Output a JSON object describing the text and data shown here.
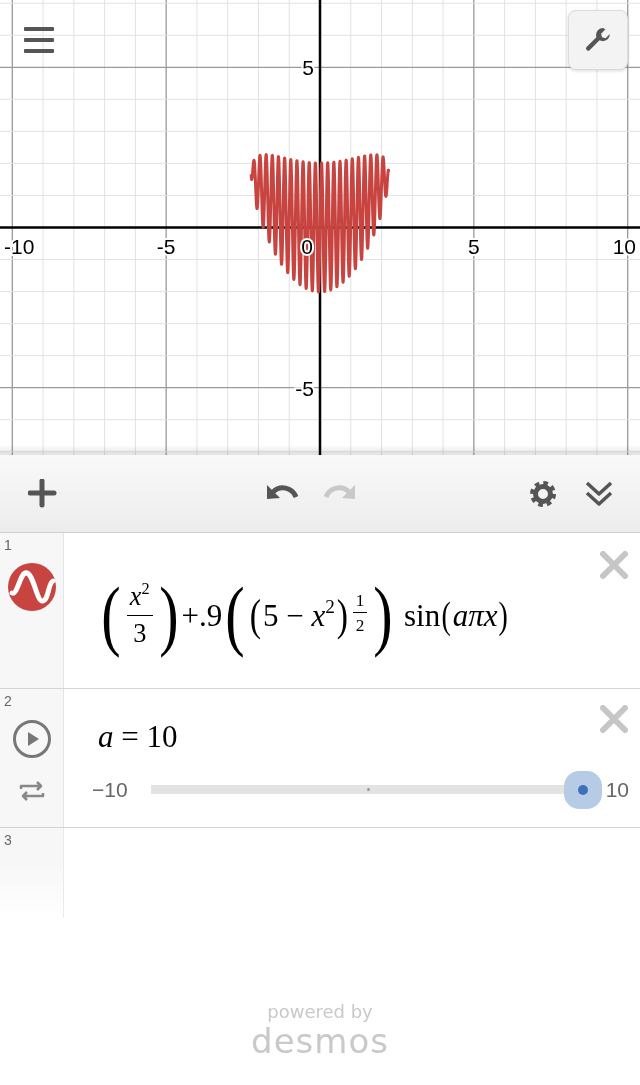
{
  "graph": {
    "chart_data": {
      "type": "line",
      "grid": true,
      "xlim": [
        -10.4,
        10.4
      ],
      "ylim": [
        -7.1,
        7.1
      ],
      "xticks": [
        {
          "value": -10,
          "label": "-10"
        },
        {
          "value": -5,
          "label": "-5"
        },
        {
          "value": 5,
          "label": "5"
        },
        {
          "value": 10,
          "label": "10"
        }
      ],
      "yticks": [
        {
          "value": -5,
          "label": "-5"
        },
        {
          "value": 5,
          "label": "5"
        }
      ]
    },
    "origin_label": "0"
  },
  "toolbar": {
    "buttons": [
      {
        "kind": "add",
        "disabled": false
      },
      {
        "kind": "undo",
        "disabled": false
      },
      {
        "kind": "redo",
        "disabled": true
      },
      {
        "kind": "settings",
        "disabled": false
      },
      {
        "kind": "collapse",
        "disabled": false
      }
    ]
  },
  "expressions": [
    {
      "kind": "function",
      "number": "1",
      "color": "#c74440",
      "math": [
        {
          "kind": "paren",
          "open": "(",
          "close": ")",
          "children": [
            {
              "kind": "frac",
              "num": [
                {
                  "kind": "text",
                  "text": "x",
                  "italic": true
                },
                {
                  "kind": "sup",
                  "children": [
                    {
                      "kind": "text",
                      "text": "2",
                      "italic": false
                    }
                  ]
                }
              ],
              "den": [
                {
                  "kind": "text",
                  "text": "3",
                  "italic": false
                }
              ]
            }
          ]
        },
        {
          "kind": "text",
          "text": "+.9",
          "italic": false
        },
        {
          "kind": "paren",
          "open": "(",
          "close": ")",
          "children": [
            {
              "kind": "paren",
              "open": "(",
              "close": ")",
              "children": [
                {
                  "kind": "text",
                  "text": "5 − ",
                  "italic": false
                },
                {
                  "kind": "text",
                  "text": "x",
                  "italic": true
                },
                {
                  "kind": "sup",
                  "children": [
                    {
                      "kind": "text",
                      "text": "2",
                      "italic": false
                    }
                  ]
                }
              ]
            },
            {
              "kind": "sup",
              "children": [
                {
                  "kind": "frac",
                  "num": [
                    {
                      "kind": "text",
                      "text": "1",
                      "italic": false
                    }
                  ],
                  "den": [
                    {
                      "kind": "text",
                      "text": "2",
                      "italic": false
                    }
                  ]
                }
              ]
            }
          ]
        },
        {
          "kind": "text",
          "text": " sin",
          "italic": false
        },
        {
          "kind": "paren",
          "open": "(",
          "close": ")",
          "children": [
            {
              "kind": "text",
              "text": "aπx",
              "italic": true
            }
          ]
        }
      ]
    },
    {
      "kind": "slider",
      "number": "2",
      "math": [
        {
          "kind": "text",
          "text": "a",
          "italic": true
        },
        {
          "kind": "text",
          "text": " = 10",
          "italic": false
        }
      ],
      "slider": {
        "min": "−10",
        "max": "10"
      }
    },
    {
      "kind": "empty",
      "number": "3"
    }
  ],
  "footer": {
    "powered_by": "powered by",
    "brand": "desmos"
  }
}
